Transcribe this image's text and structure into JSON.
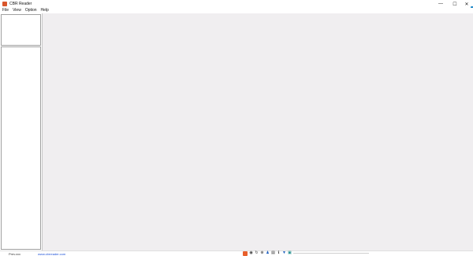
{
  "window": {
    "title": "CBR Reader",
    "minimize_glyph": "—",
    "maximize_glyph": "☐",
    "close_glyph": "✕"
  },
  "menu": {
    "items": [
      "File",
      "View",
      "Option",
      "Help"
    ]
  },
  "status": {
    "prev_button": "Prev.xxx",
    "link_text": "www.cbrreader.com"
  },
  "toolbar_icons": [
    {
      "name": "app-logo-icon",
      "glyph": ""
    },
    {
      "name": "eye-icon",
      "glyph": "◉"
    },
    {
      "name": "rotate-icon",
      "glyph": "↻"
    },
    {
      "name": "zoom-icon",
      "glyph": "⊕"
    },
    {
      "name": "user-icon",
      "glyph": "♟"
    },
    {
      "name": "print-icon",
      "glyph": "▤"
    },
    {
      "name": "info-icon",
      "glyph": "ℹ"
    },
    {
      "name": "down-arrow-icon",
      "glyph": "▼"
    },
    {
      "name": "page-icon",
      "glyph": "▣"
    }
  ]
}
